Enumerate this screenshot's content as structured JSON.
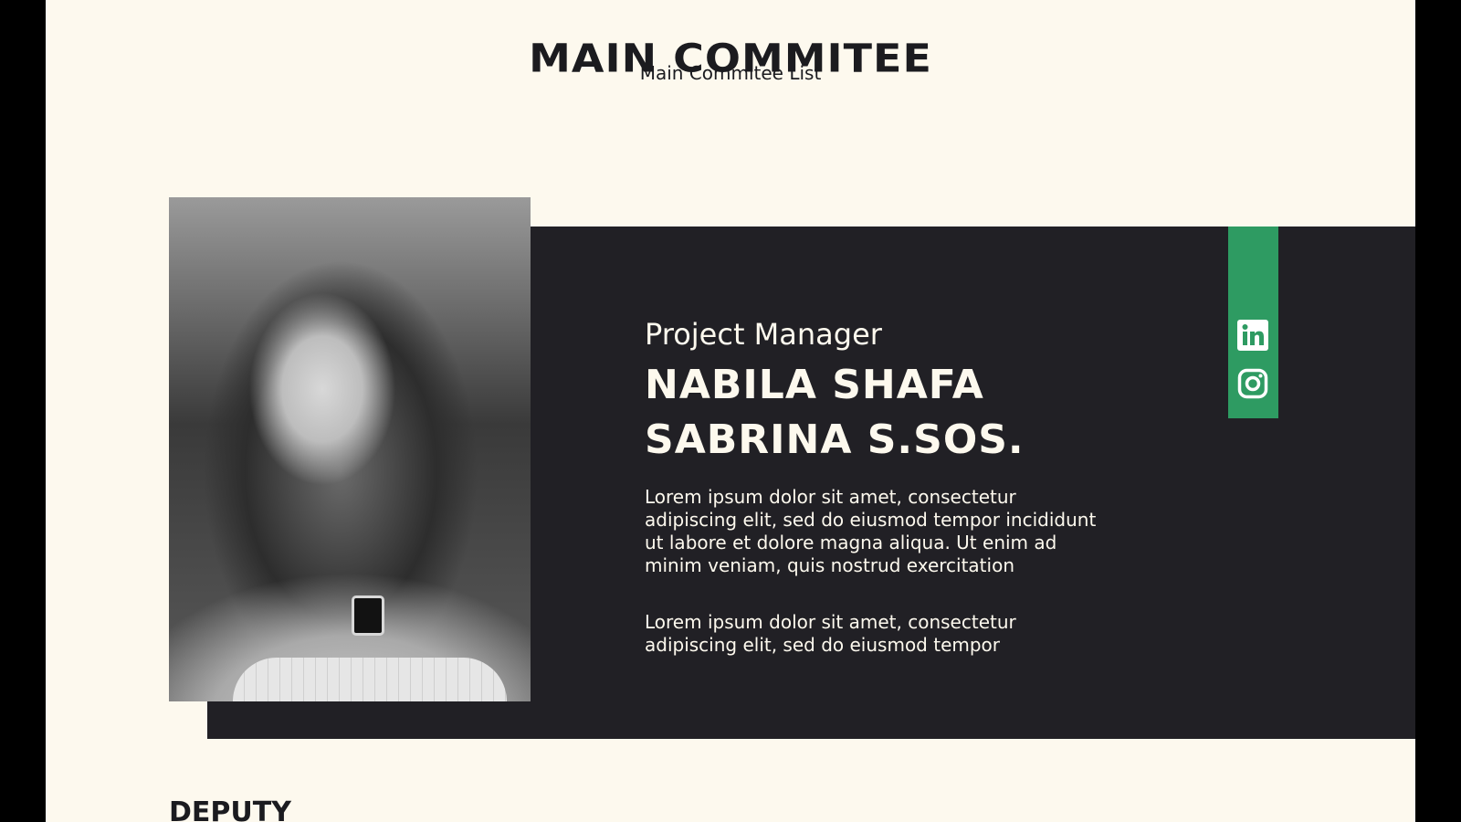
{
  "header": {
    "title": "MAIN COMMITEE",
    "subtitle": "Main Commitee List"
  },
  "member": {
    "role": "Project Manager",
    "name_line_1": "NABILA SHAFA",
    "name_line_2": "SABRINA S.SOS.",
    "paragraph_1": "Lorem ipsum dolor sit amet, consectetur adipiscing elit, sed do eiusmod tempor incididunt ut labore et dolore magna aliqua. Ut enim ad minim veniam, quis nostrud exercitation",
    "paragraph_2": "Lorem ipsum dolor sit amet, consectetur adipiscing elit, sed do eiusmod tempor",
    "photo_icon": "portrait-photo"
  },
  "social": {
    "links": [
      {
        "icon": "linkedin-icon"
      },
      {
        "icon": "instagram-icon"
      }
    ]
  },
  "next_section": {
    "heading": "DEPUTY"
  },
  "colors": {
    "page_background": "#fdf9ee",
    "outer_background": "#000000",
    "card_background": "#212025",
    "accent_green": "#2e9b62",
    "text_dark": "#1b1b1f",
    "text_light": "#fdf9ee"
  }
}
